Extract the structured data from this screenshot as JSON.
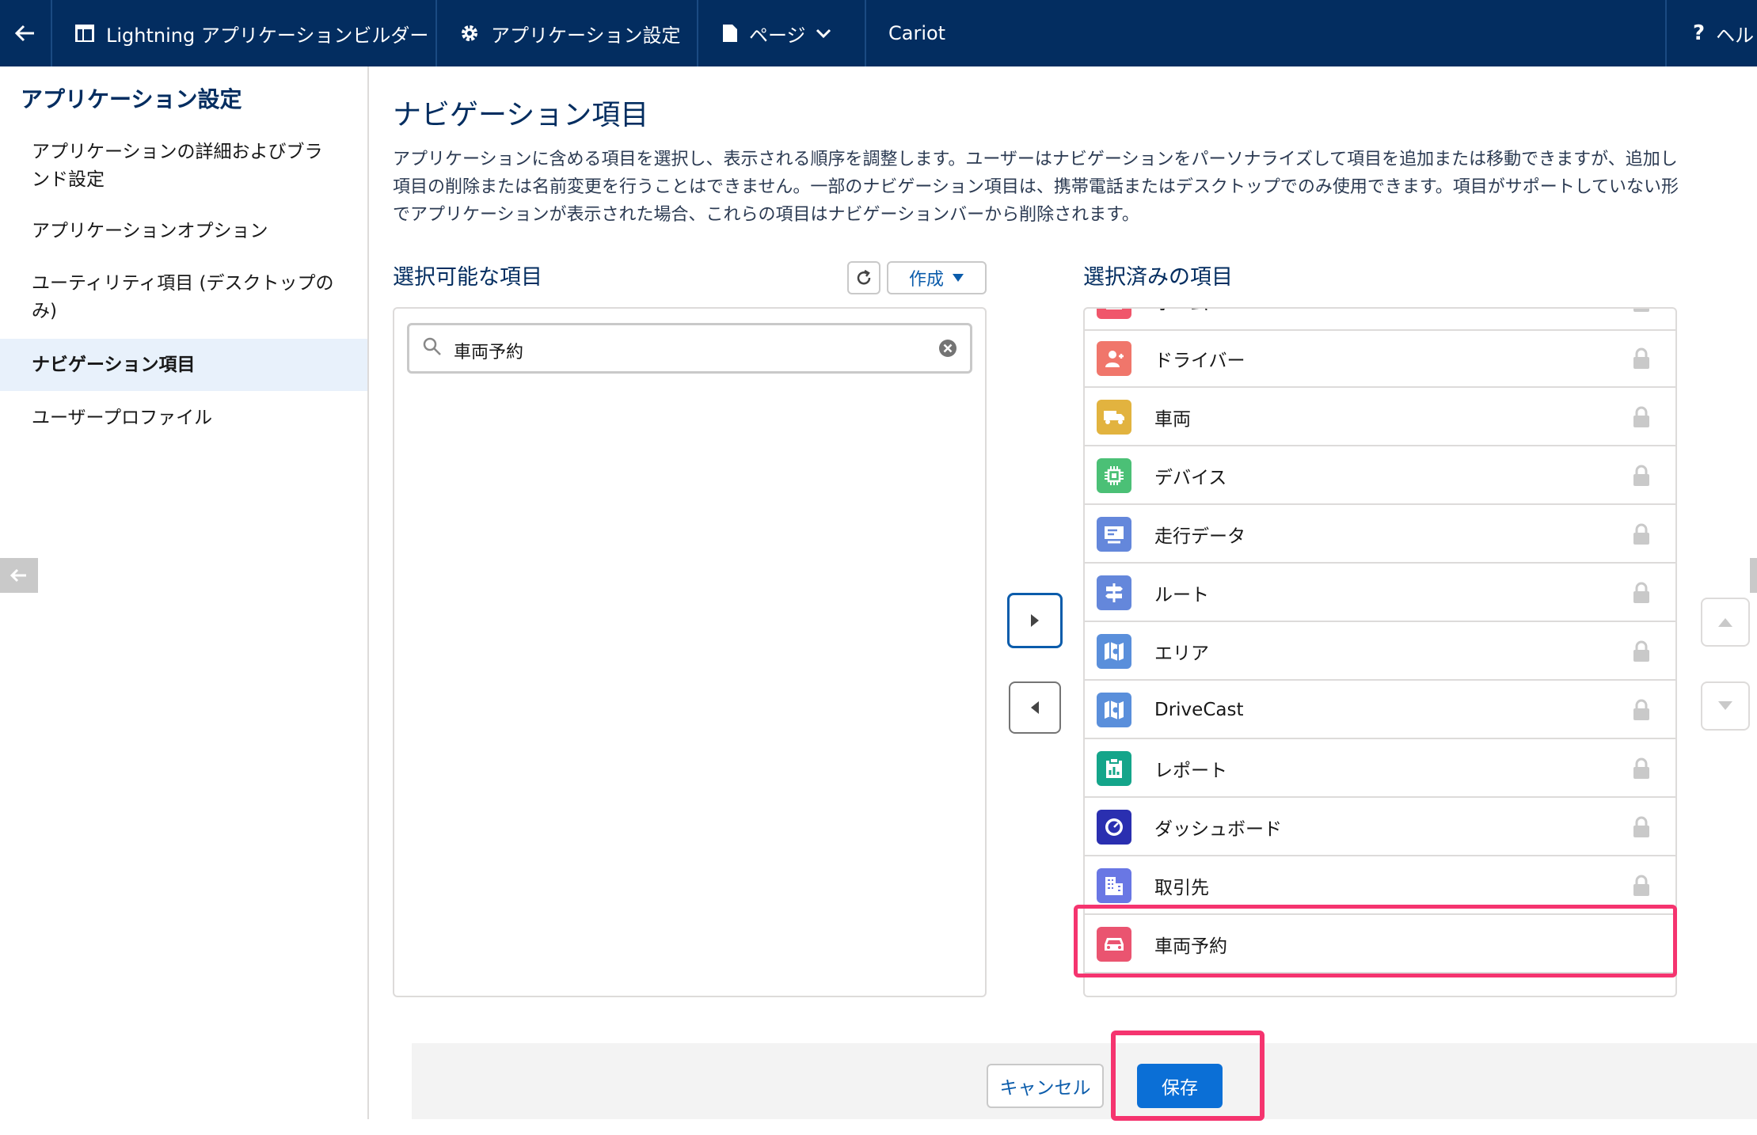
{
  "topbar": {
    "back_icon": "arrow-left-icon",
    "builder_label": "Lightning アプリケーションビルダー",
    "settings_label": "アプリケーション設定",
    "page_label": "ページ",
    "app_name": "Cariot",
    "help_label": "ヘル",
    "help_glyph": "?"
  },
  "sidebar": {
    "title": "アプリケーション設定",
    "items": [
      {
        "label": "アプリケーションの詳細およびブランド設定",
        "active": false
      },
      {
        "label": "アプリケーションオプション",
        "active": false
      },
      {
        "label": "ユーティリティ項目 (デスクトップのみ)",
        "active": false
      },
      {
        "label": "ナビゲーション項目",
        "active": true
      },
      {
        "label": "ユーザープロファイル",
        "active": false
      }
    ]
  },
  "main": {
    "title": "ナビゲーション項目",
    "description": "アプリケーションに含める項目を選択し、表示される順序を調整します。ユーザーはナビゲーションをパーソナライズして項目を追加または移動できますが、追加し\n項目の削除または名前変更を行うことはできません。一部のナビゲーション項目は、携帯電話またはデスクトップでのみ使用できます。項目がサポートしていない形\nでアプリケーションが表示された場合、これらの項目はナビゲーションバーから削除されます。",
    "available_label": "選択可能な項目",
    "create_label": "作成",
    "search_value": "車両予約",
    "selected_label": "選択済みの項目",
    "selected_items": [
      {
        "label": "ホーム",
        "icon": "home-icon",
        "color": "#f0566b"
      },
      {
        "label": "ドライバー",
        "icon": "person-icon",
        "color": "#f0766b"
      },
      {
        "label": "車両",
        "icon": "truck-icon",
        "color": "#e2b33f"
      },
      {
        "label": "デバイス",
        "icon": "chip-icon",
        "color": "#4bc076"
      },
      {
        "label": "走行データ",
        "icon": "dashboard-card-icon",
        "color": "#6487db"
      },
      {
        "label": "ルート",
        "icon": "signpost-icon",
        "color": "#6487db"
      },
      {
        "label": "エリア",
        "icon": "map-icon",
        "color": "#5a8fdb"
      },
      {
        "label": "DriveCast",
        "icon": "map-icon",
        "color": "#5a8fdb"
      },
      {
        "label": "レポート",
        "icon": "report-icon",
        "color": "#14a58a"
      },
      {
        "label": "ダッシュボード",
        "icon": "gauge-icon",
        "color": "#2a2fb0"
      },
      {
        "label": "取引先",
        "icon": "building-icon",
        "color": "#6977e4"
      },
      {
        "label": "車両予約",
        "icon": "car-icon",
        "color": "#ea5470"
      }
    ]
  },
  "footer": {
    "cancel_label": "キャンセル",
    "save_label": "保存"
  },
  "colors": {
    "topbar_bg": "#032d60",
    "brand_blue": "#0b6fd6",
    "highlight": "#f5346f"
  }
}
